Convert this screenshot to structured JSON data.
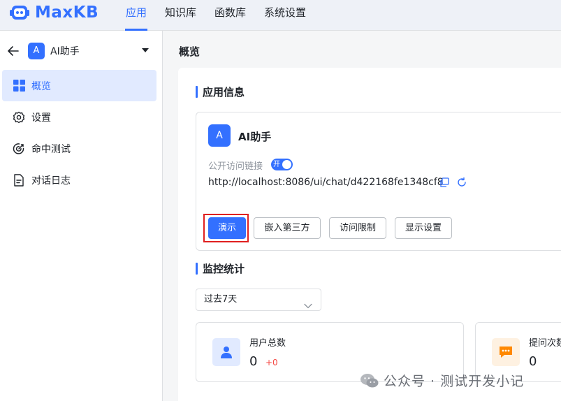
{
  "brand": {
    "name": "MaxKB",
    "color": "#3370ff"
  },
  "nav": {
    "items": [
      {
        "label": "应用",
        "active": true
      },
      {
        "label": "知识库",
        "active": false
      },
      {
        "label": "函数库",
        "active": false
      },
      {
        "label": "系统设置",
        "active": false
      }
    ]
  },
  "sidebar": {
    "app_avatar": "A",
    "app_name": "AI助手",
    "menu": [
      {
        "label": "概览",
        "icon": "grid-icon",
        "active": true
      },
      {
        "label": "设置",
        "icon": "gear-icon",
        "active": false
      },
      {
        "label": "命中测试",
        "icon": "target-icon",
        "active": false
      },
      {
        "label": "对话日志",
        "icon": "document-icon",
        "active": false
      }
    ]
  },
  "main": {
    "page_title": "概览",
    "app_info": {
      "section_title": "应用信息",
      "avatar": "A",
      "name": "AI助手",
      "public_link_label": "公开访问链接",
      "toggle_label": "开",
      "toggle_on": true,
      "url": "http://localhost:8086/ui/chat/d422168fe1348cf8",
      "buttons": {
        "demo": "演示",
        "embed": "嵌入第三方",
        "access_limit": "访问限制",
        "display_settings": "显示设置"
      }
    },
    "monitor": {
      "section_title": "监控统计",
      "range_select": "过去7天",
      "stats": [
        {
          "label": "用户总数",
          "value": "0",
          "delta": "+0",
          "icon": "user-icon"
        },
        {
          "label": "提问次数",
          "value": "0",
          "icon": "chat-icon"
        }
      ]
    }
  },
  "watermark": {
    "text": "公众号 · 测试开发小记"
  }
}
